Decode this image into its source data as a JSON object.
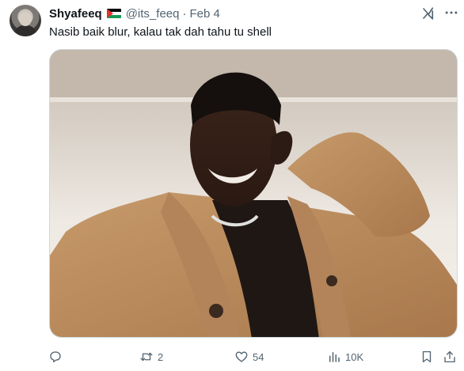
{
  "author": {
    "display_name": "Shyafeeq",
    "flag_icon": "palestine-flag-icon",
    "handle": "@its_feeq",
    "separator": "·",
    "date": "Feb 4"
  },
  "tweet": {
    "text": "Nasib baik blur, kalau tak dah tahu tu shell"
  },
  "media": {
    "description_icon": "photo"
  },
  "actions": {
    "reply_count": "",
    "repost_count": "2",
    "like_count": "54",
    "views_count": "10K"
  },
  "icons": {
    "top_right": [
      "grok-icon",
      "more-icon"
    ],
    "actions": [
      "reply-icon",
      "repost-icon",
      "like-icon",
      "views-icon",
      "bookmark-icon",
      "share-icon"
    ]
  },
  "colors": {
    "text_primary": "#0f1419",
    "text_secondary": "#536471",
    "border": "#cfd9de"
  }
}
